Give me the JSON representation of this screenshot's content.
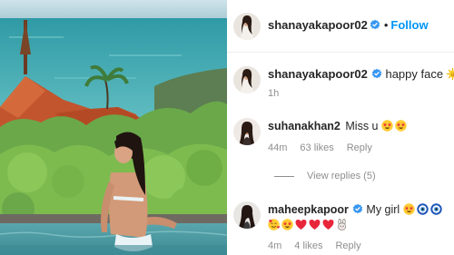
{
  "header": {
    "username": "shanayakapoor02",
    "separator": "•",
    "follow_label": "Follow"
  },
  "caption": {
    "username": "shanayakapoor02",
    "text": "happy face",
    "time": "1h",
    "emoji": [
      "sun-with-face"
    ]
  },
  "comments": [
    {
      "username": "suhanakhan2",
      "text": "Miss u",
      "emoji": [
        "star-struck",
        "star-struck"
      ],
      "time": "44m",
      "likes": "63 likes",
      "reply_label": "Reply",
      "view_replies": "View replies (5)"
    },
    {
      "username": "maheepkapoor",
      "text": "My girl",
      "emoji_line1": [
        "star-struck",
        "nazar-amulet",
        "nazar-amulet"
      ],
      "emoji_line2": [
        "smiling-hearts",
        "star-struck",
        "red-heart",
        "red-heart",
        "red-heart",
        "rabbit"
      ],
      "time": "4m",
      "likes": "4 likes",
      "reply_label": "Reply"
    }
  ],
  "colors": {
    "verified": "#3897f0",
    "follow": "#0095f6",
    "secondary_text": "#8e8e8e",
    "primary_text": "#262626"
  }
}
